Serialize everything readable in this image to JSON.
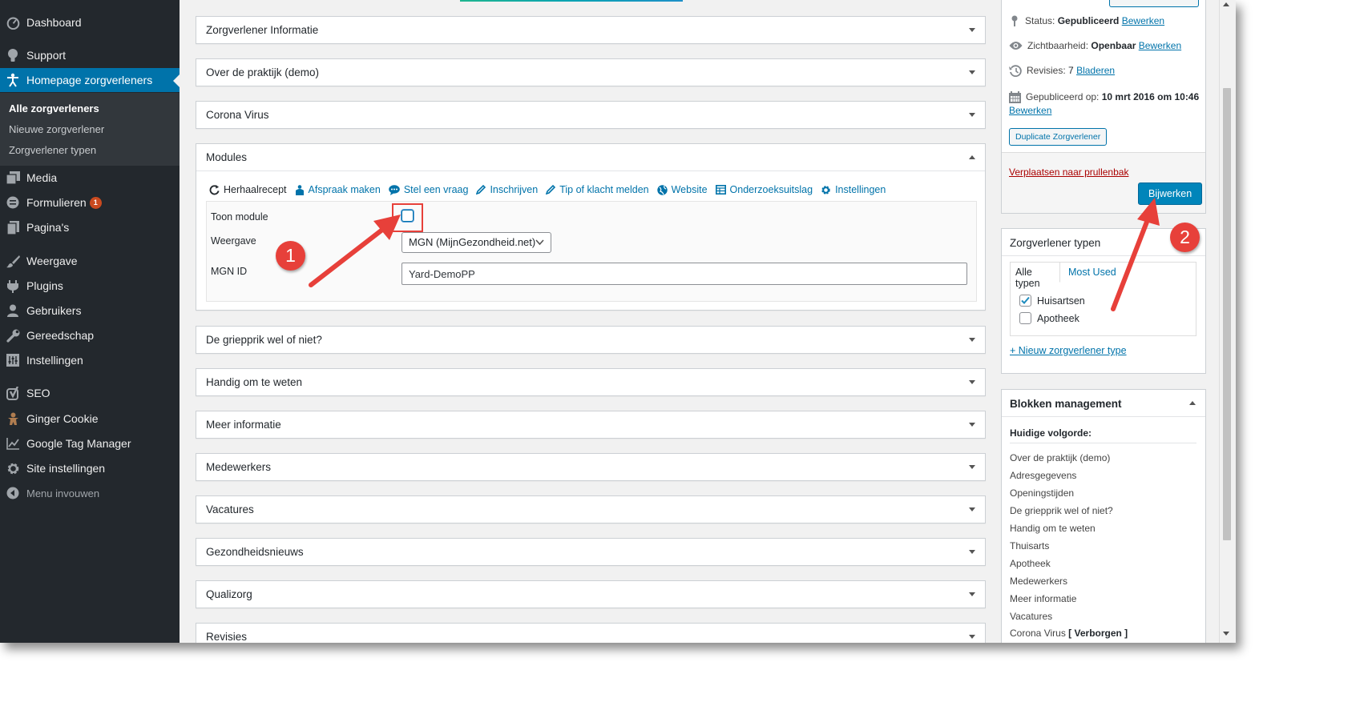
{
  "sidebar": {
    "items": [
      {
        "label": "Dashboard",
        "icon": "dashboard-icon"
      },
      {
        "label": "Support",
        "icon": "lightbulb-icon"
      },
      {
        "label": "Homepage zorgverleners",
        "icon": "universal-access-icon"
      },
      {
        "label": "Media",
        "icon": "media-icon"
      },
      {
        "label": "Formulieren",
        "icon": "forms-icon",
        "badge": "1"
      },
      {
        "label": "Pagina's",
        "icon": "pages-icon"
      },
      {
        "label": "Weergave",
        "icon": "appearance-icon"
      },
      {
        "label": "Plugins",
        "icon": "plugins-icon"
      },
      {
        "label": "Gebruikers",
        "icon": "users-icon"
      },
      {
        "label": "Gereedschap",
        "icon": "tools-icon"
      },
      {
        "label": "Instellingen",
        "icon": "settings-icon"
      },
      {
        "label": "SEO",
        "icon": "yoast-icon"
      },
      {
        "label": "Ginger Cookie",
        "icon": "gingerbread-icon"
      },
      {
        "label": "Google Tag Manager",
        "icon": "chart-line-icon"
      },
      {
        "label": "Site instellingen",
        "icon": "gear-icon"
      },
      {
        "label": "Menu invouwen",
        "icon": "collapse-icon"
      }
    ],
    "submenu": [
      "Alle zorgverleners",
      "Nieuwe zorgverlener",
      "Zorgverlener typen"
    ]
  },
  "main": {
    "boxes": [
      "Zorgverlener Informatie",
      "Over de praktijk (demo)",
      "Corona Virus",
      "Modules",
      "De griepprik wel of niet?",
      "Handig om te weten",
      "Meer informatie",
      "Medewerkers",
      "Vacatures",
      "Gezondheidsnieuws",
      "Qualizorg",
      "Revisies"
    ],
    "modules": {
      "tabs": [
        "Herhaalrecept",
        "Afspraak maken",
        "Stel een vraag",
        "Inschrijven",
        "Tip of klacht melden",
        "Website",
        "Onderzoeksuitslag",
        "Instellingen"
      ],
      "toon_module_label": "Toon module",
      "weergave_label": "Weergave",
      "weergave_value": "MGN (MijnGezondheid.net)",
      "mgn_id_label": "MGN ID",
      "mgn_id_value": "Yard-DemoPP"
    }
  },
  "publish": {
    "status_label": "Status:",
    "status_value": "Gepubliceerd",
    "visibility_label": "Zichtbaarheid:",
    "visibility_value": "Openbaar",
    "revisions_label": "Revisies:",
    "revisions_value": "7",
    "revisions_link": "Bladeren",
    "published_label": "Gepubliceerd op:",
    "published_value": "10 mrt 2016 om 10:46",
    "edit_link": "Bewerken",
    "duplicate_button": "Duplicate Zorgverlener",
    "trash_link": "Verplaatsen naar prullenbak",
    "update_button": "Bijwerken"
  },
  "types": {
    "title": "Zorgverlener typen",
    "tab_all": "Alle typen",
    "tab_most_used": "Most Used",
    "items": [
      {
        "label": "Huisartsen",
        "checked": true
      },
      {
        "label": "Apotheek",
        "checked": false
      }
    ],
    "add_link": "+ Nieuw zorgverlener type"
  },
  "blocks": {
    "title": "Blokken management",
    "order_label": "Huidige volgorde:",
    "items": [
      "Over de praktijk (demo)",
      "Adresgegevens",
      "Openingstijden",
      "De griepprik wel of niet?",
      "Handig om te weten",
      "Thuisarts",
      "Apotheek",
      "Medewerkers",
      "Meer informatie",
      "Vacatures",
      "Corona Virus"
    ],
    "hidden_tag": "[ Verborgen ]"
  },
  "annotations": {
    "step1": "1",
    "step2": "2",
    "color": "#e7403a"
  },
  "colors": {
    "admin_sidebar": "#23282d",
    "accent": "#0073aa",
    "primary_button": "#0085ba",
    "badge": "#ca4a1f",
    "trash": "#a00000"
  }
}
